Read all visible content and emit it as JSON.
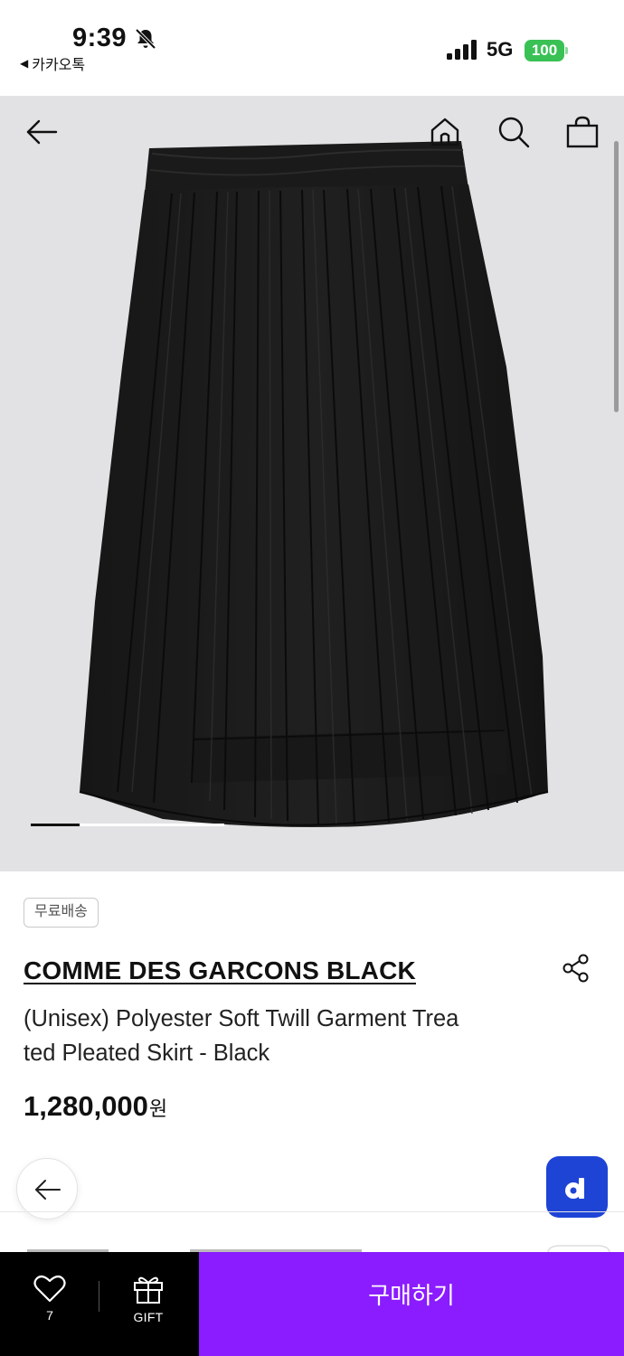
{
  "status_bar": {
    "time": "9:39",
    "back_app": "카카오톡",
    "network": "5G",
    "battery": "100"
  },
  "hero": {
    "image_progress": 0.25
  },
  "product": {
    "badge": "무료배송",
    "brand": "COMME DES GARCONS BLACK",
    "name_line1": "(Unisex) Polyester Soft Twill Garment Trea",
    "name_line2": "ted Pleated Skirt - Black",
    "price": "1,280,000",
    "price_unit": "원"
  },
  "bottom_bar": {
    "like_count": "7",
    "gift_label": "GIFT",
    "buy_label": "구매하기"
  },
  "colors": {
    "buy_button": "#8b1cff",
    "app_fab": "#1e44d6",
    "battery": "#3ac155"
  },
  "icons": [
    "back-arrow-icon",
    "home-icon",
    "search-icon",
    "shopping-bag-icon",
    "share-icon",
    "heart-icon",
    "gift-icon",
    "bell-slash-icon",
    "signal-icon",
    "app-logo-icon"
  ]
}
